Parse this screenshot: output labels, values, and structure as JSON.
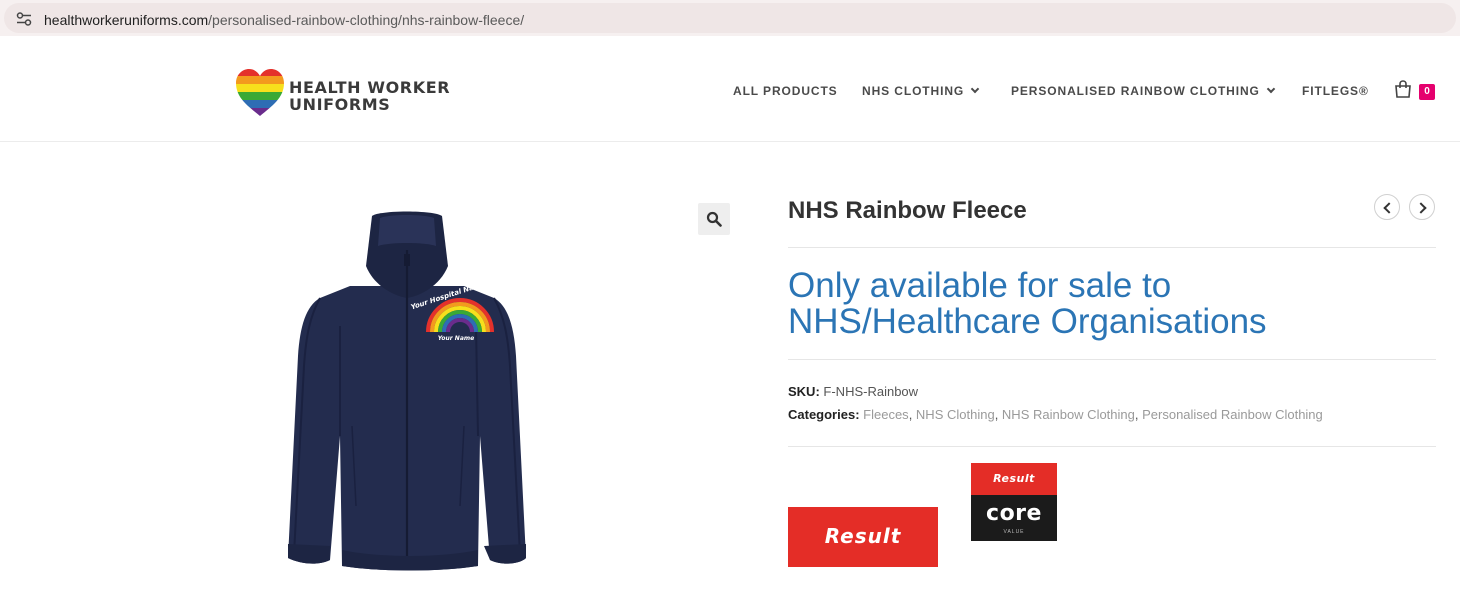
{
  "browser": {
    "url_host": "healthworkeruniforms.com",
    "url_path": "/personalised-rainbow-clothing/nhs-rainbow-fleece/"
  },
  "header": {
    "logo_line1": "HEALTH WORKER",
    "logo_line2": "UNIFORMS",
    "nav": [
      {
        "label": "ALL PRODUCTS",
        "has_dropdown": false
      },
      {
        "label": "NHS CLOTHING",
        "has_dropdown": true
      },
      {
        "label": "PERSONALISED RAINBOW CLOTHING",
        "has_dropdown": true
      },
      {
        "label": "FITLEGS®",
        "has_dropdown": false
      }
    ],
    "cart_count": "0",
    "badge_color": "#e5006e"
  },
  "product": {
    "title": "NHS Rainbow Fleece",
    "availability": "Only available for sale to NHS/Healthcare Organisations",
    "availability_color": "#2b75b5",
    "sku_label": "SKU:",
    "sku": "F-NHS-Rainbow",
    "categories_label": "Categories:",
    "categories": [
      "Fleeces",
      "NHS Clothing",
      "NHS Rainbow Clothing",
      "Personalised Rainbow Clothing"
    ],
    "image_text_top": "Your Hospital Name Here",
    "image_text_bottom": "Your Name",
    "jacket_color": "#232c4e"
  },
  "brands": {
    "result": "Result",
    "core_result": "Result",
    "core_word": "core",
    "core_value": "VALUE",
    "brand_red": "#e42d27"
  }
}
